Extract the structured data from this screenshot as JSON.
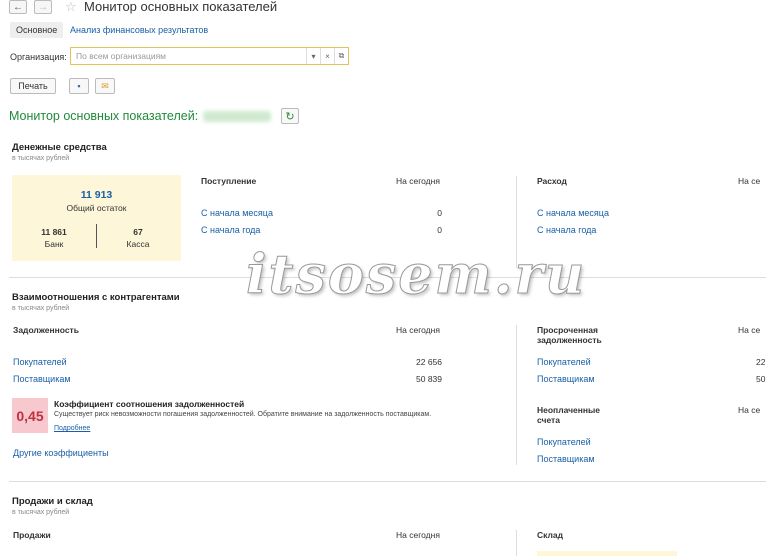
{
  "header": {
    "title": "Монитор основных показателей"
  },
  "tabs": {
    "main": "Основное",
    "analysis": "Анализ финансовых результатов"
  },
  "org": {
    "label": "Организация:",
    "placeholder": "По всем организациям"
  },
  "toolbar": {
    "print": "Печать"
  },
  "monitor": {
    "title": "Монитор основных показателей:"
  },
  "units": "в тысячах рублей",
  "cash": {
    "title": "Денежные средства",
    "total_value": "11 913",
    "total_label": "Общий остаток",
    "bank_value": "11 861",
    "bank_label": "Банк",
    "kassa_value": "67",
    "kassa_label": "Касса",
    "income": {
      "header": "Поступление",
      "today": "На сегодня",
      "rows": [
        {
          "label": "С начала месяца",
          "value": "0"
        },
        {
          "label": "С начала года",
          "value": "0"
        }
      ]
    },
    "expense": {
      "header": "Расход",
      "today": "На се",
      "rows": [
        {
          "label": "С начала месяца"
        },
        {
          "label": "С начала года"
        }
      ]
    }
  },
  "counterparties": {
    "title": "Взаимоотношения с контрагентами",
    "debt": {
      "header": "Задолженность",
      "today": "На сегодня",
      "rows": [
        {
          "label": "Покупателей",
          "value": "22 656"
        },
        {
          "label": "Поставщикам",
          "value": "50 839"
        }
      ]
    },
    "ratio": {
      "value": "0,45",
      "title": "Коэффициент соотношения задолженностей",
      "desc": "Существует риск невозможности погашения задолженностей. Обратите внимание на задолженность поставщикам.",
      "more": "Подробнее"
    },
    "other": "Другие коэффициенты",
    "overdue": {
      "header_1": "Просроченная",
      "header_2": "задолженность",
      "today": "На се",
      "rows": [
        {
          "label": "Покупателей",
          "value": "22"
        },
        {
          "label": "Поставщикам",
          "value": "50"
        }
      ]
    },
    "unpaid": {
      "header_1": "Неоплаченные",
      "header_2": "счета",
      "today": "На се",
      "rows": [
        {
          "label": "Покупателей"
        },
        {
          "label": "Поставщикам"
        }
      ]
    }
  },
  "sales": {
    "title": "Продажи и склад",
    "sales_header": "Продажи",
    "today": "На сегодня",
    "stock_header": "Склад"
  },
  "watermark": "itsosem.ru",
  "colors": {
    "link": "#1a5fa8",
    "green_title": "#1e8a3a",
    "yellow_panel": "#fdf6d8",
    "ratio_bg": "#f7c8ce",
    "ratio_text": "#c03040"
  }
}
